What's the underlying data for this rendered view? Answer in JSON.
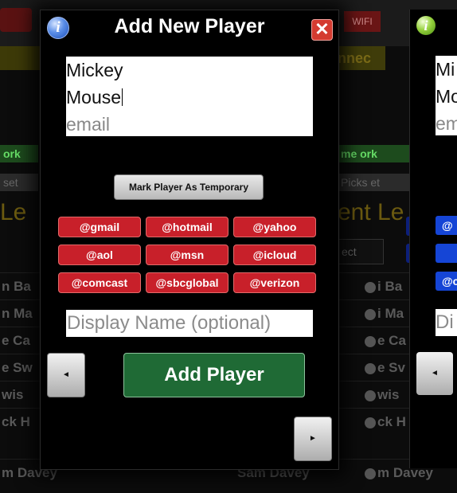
{
  "background": {
    "wifi_label": "WIFI",
    "connected_label": "nnec",
    "left_green_label": "ork",
    "left_gray_label": "set",
    "left_big_label": "Le",
    "right_green_label": "me ork",
    "right_gray_label": "Picks et",
    "right_big_label": "ent Le",
    "select_label": "ect",
    "left_rows": [
      "n Ba",
      "n Ma",
      "e Ca",
      "e Sw",
      "wis",
      "ck H",
      "m Davey"
    ],
    "right_rows": [
      "i Ba",
      "i Ma",
      "e Ca",
      "e Sv",
      "wis",
      "ck H",
      "m Davey"
    ],
    "bottom_name": "Sam Davey"
  },
  "dialog": {
    "title": "Add New Player",
    "info_icon": "i",
    "close_icon": "✕",
    "first_name": "Mickey",
    "last_name": "Mouse",
    "email_placeholder": "email",
    "temp_button": "Mark Player As Temporary",
    "domains": [
      "@gmail",
      "@hotmail",
      "@yahoo",
      "@aol",
      "@msn",
      "@icloud",
      "@comcast",
      "@sbcglobal",
      "@verizon"
    ],
    "display_name_placeholder": "Display Name (optional)",
    "prev_icon": "◄",
    "next_icon": "►",
    "add_button": "Add Player"
  },
  "dialog2": {
    "info_icon": "i",
    "first_name": "Mi",
    "last_name": "Mo",
    "email_placeholder": "em",
    "blue_1": "@",
    "blue_3": "@c",
    "display_partial": "Di",
    "prev_icon": "◄"
  },
  "colors": {
    "domain_red": "#c8202a",
    "add_green": "#1f6a35",
    "close_red": "#d43b30",
    "partial_blue": "#1545d6"
  }
}
